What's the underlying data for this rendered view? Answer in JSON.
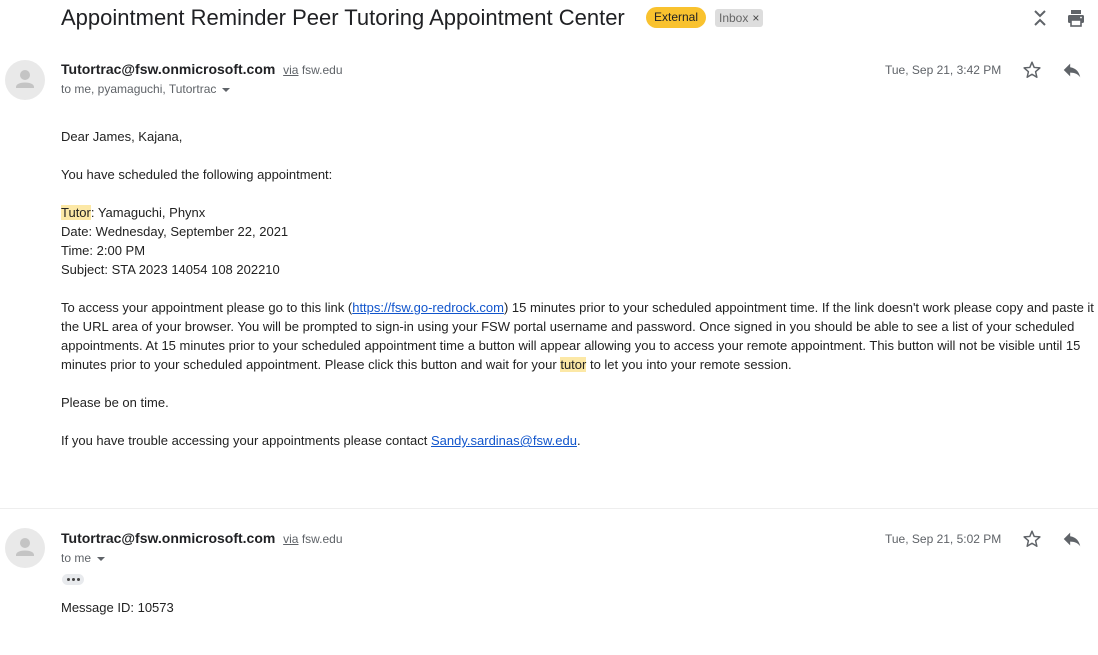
{
  "thread": {
    "subject": "Appointment Reminder Peer Tutoring Appointment Center",
    "badge_external": "External",
    "badge_inbox": "Inbox",
    "badge_inbox_close": "×"
  },
  "messages": [
    {
      "sender": "Tutortrac@fsw.onmicrosoft.com",
      "via_word": "via",
      "via_domain": "fsw.edu",
      "recipients": "to me, pyamaguchi, Tutortrac",
      "date": "Tue, Sep 21, 3:42 PM",
      "body": {
        "greeting": "Dear James, Kajana,",
        "intro": "You have scheduled the following appointment:",
        "tutor_label": "Tutor",
        "tutor_value": ": Yamaguchi, Phynx",
        "date_line": "Date: Wednesday, September 22, 2021",
        "time_line": "Time: 2:00 PM",
        "subject_line": "Subject: STA 2023 14054 108 202210",
        "access_pre": "To access your appointment please go to this link (",
        "access_link": "https://fsw.go-redrock.com",
        "access_post": ") 15 minutes prior to your scheduled appointment time. If the link doesn't work please copy and paste it the URL area of your browser. You will be prompted to sign-in using your FSW portal username and password. Once signed in you should be able to see a list of your scheduled appointments. At 15 minutes prior to your scheduled appointment time a button will appear allowing you to access your remote appointment. This button will not be visible until 15 minutes prior to your scheduled appointment. Please click this button and wait for your ",
        "access_tutor": "tutor",
        "access_end": " to let you into your remote session.",
        "on_time": "Please be on time.",
        "trouble_pre": "If you have trouble accessing your appointments please contact ",
        "trouble_link": "Sandy.sardinas@fsw.edu",
        "trouble_end": "."
      }
    },
    {
      "sender": "Tutortrac@fsw.onmicrosoft.com",
      "via_word": "via",
      "via_domain": "fsw.edu",
      "recipients": "to me",
      "date": "Tue, Sep 21, 5:02 PM",
      "body": {
        "message_id": "Message ID: 10573"
      }
    }
  ],
  "icons": {
    "collapse": "collapse-all-icon",
    "print": "print-icon",
    "star": "star-icon",
    "reply": "reply-icon",
    "avatar": "person-avatar-icon",
    "more": "show-trimmed-content-icon"
  },
  "colors": {
    "external_badge": "#f9c22e",
    "inbox_badge": "#dddddd",
    "highlight": "#fce8a6",
    "link": "#1155cc"
  }
}
